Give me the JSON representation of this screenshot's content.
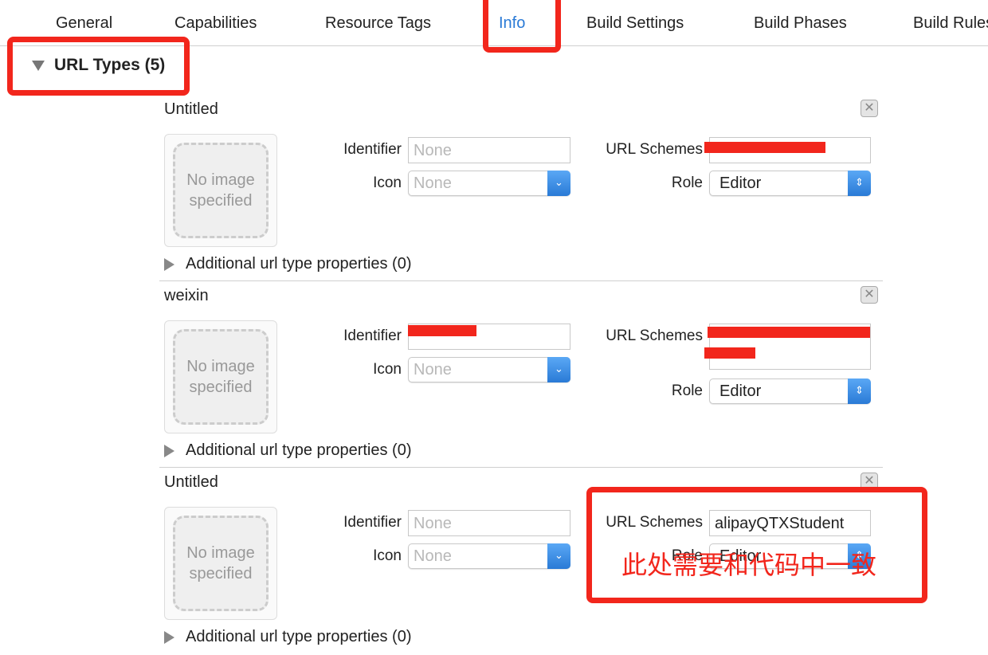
{
  "tabs": [
    {
      "label": "General"
    },
    {
      "label": "Capabilities"
    },
    {
      "label": "Resource Tags"
    },
    {
      "label": "Info",
      "active": true
    },
    {
      "label": "Build Settings"
    },
    {
      "label": "Build Phases"
    },
    {
      "label": "Build Rules"
    }
  ],
  "url_types": {
    "header": "URL Types (5)",
    "labels": {
      "identifier": "Identifier",
      "icon": "Icon",
      "url_schemes": "URL Schemes",
      "role": "Role",
      "no_image": "No image specified",
      "additional": "Additional url type properties (0)"
    },
    "items": [
      {
        "title": "Untitled",
        "identifier": "",
        "identifier_placeholder": "None",
        "icon": "None",
        "url_schemes": "[redacted]",
        "role": "Editor",
        "redacted_identifier": false
      },
      {
        "title": "weixin",
        "identifier": "[redacted]",
        "identifier_placeholder": "None",
        "icon": "None",
        "url_schemes": "[redacted]",
        "role": "Editor",
        "redacted_identifier": true
      },
      {
        "title": "Untitled",
        "identifier": "",
        "identifier_placeholder": "None",
        "icon": "None",
        "url_schemes": "alipayQTXStudent",
        "role": "Editor",
        "redacted_identifier": false
      }
    ]
  },
  "annotation": {
    "text": "此处需要和代码中一致",
    "color": "#f2261c"
  },
  "colors": {
    "accent": "#2a7ad6",
    "annotation": "#f2261c"
  }
}
